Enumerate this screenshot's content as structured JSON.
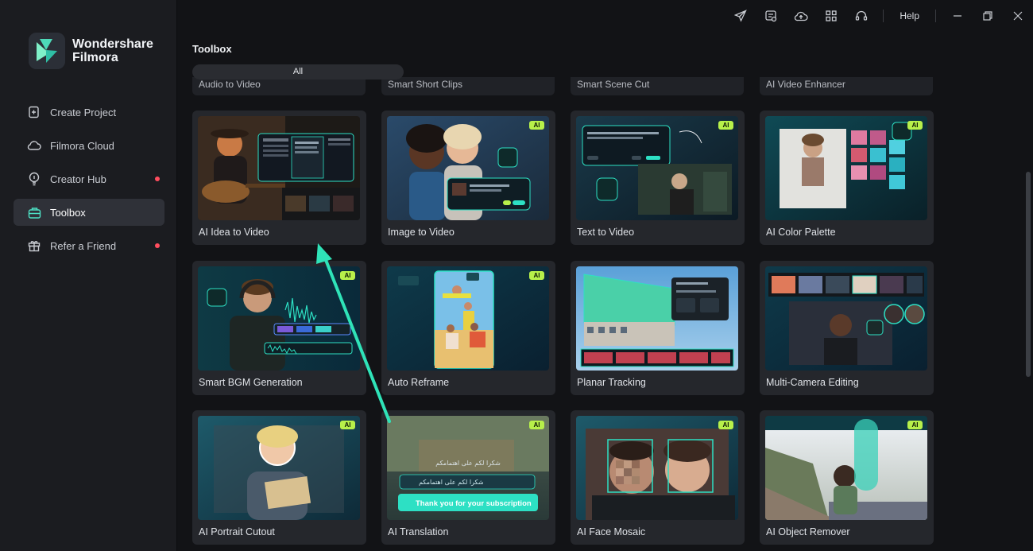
{
  "app": {
    "logo_line1": "Wondershare",
    "logo_line2": "Filmora",
    "brand_colors": {
      "teal": "#2de0c4",
      "green": "#b7f04a"
    }
  },
  "sidebar": {
    "items": [
      {
        "label": "Create Project",
        "icon": "create-project-icon",
        "active": false,
        "dot": false
      },
      {
        "label": "Filmora Cloud",
        "icon": "cloud-icon",
        "active": false,
        "dot": false
      },
      {
        "label": "Creator Hub",
        "icon": "lightbulb-icon",
        "active": false,
        "dot": true
      },
      {
        "label": "Toolbox",
        "icon": "toolbox-icon",
        "active": true,
        "dot": false
      },
      {
        "label": "Refer a Friend",
        "icon": "gift-icon",
        "active": false,
        "dot": true
      }
    ]
  },
  "titlebar": {
    "help_label": "Help",
    "icons": [
      "send-icon",
      "feedback-icon",
      "cloud-upload-icon",
      "grid-icon",
      "headset-icon"
    ]
  },
  "main": {
    "title": "Toolbox",
    "filter_all": "All",
    "previous_row": [
      "Audio to Video",
      "Smart Short Clips",
      "Smart Scene Cut",
      "AI Video Enhancer"
    ],
    "cards": [
      {
        "label": "AI Idea to Video",
        "ai": false
      },
      {
        "label": "Image to Video",
        "ai": true
      },
      {
        "label": "Text to Video",
        "ai": true
      },
      {
        "label": "AI Color Palette",
        "ai": true
      },
      {
        "label": "Smart BGM Generation",
        "ai": true
      },
      {
        "label": "Auto Reframe",
        "ai": true
      },
      {
        "label": "Planar Tracking",
        "ai": false
      },
      {
        "label": "Multi-Camera Editing",
        "ai": false
      },
      {
        "label": "AI Portrait Cutout",
        "ai": true
      },
      {
        "label": "AI Translation",
        "ai": true
      },
      {
        "label": "AI Face Mosaic",
        "ai": true
      },
      {
        "label": "AI Object Remover",
        "ai": true
      }
    ],
    "ai_badge": "AI",
    "overlay_texts": {
      "translation_arabic_1": "شكرا لكم على اهتمامكم",
      "translation_arabic_2": "شكرا لكم على اهتمامكم",
      "translation_english": "Thank you for your subscription"
    }
  }
}
